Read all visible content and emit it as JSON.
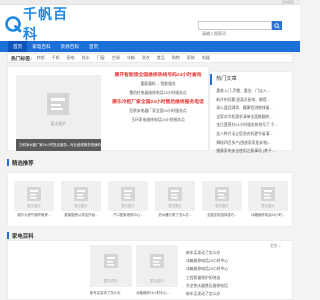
{
  "topbar": {
    "fav_label": "设为首页"
  },
  "logo": {
    "text": "千帆百科"
  },
  "search": {
    "placeholder": "请输入搜索词",
    "button_icon": "search-icon"
  },
  "nav": {
    "items": [
      "首页",
      "家电百科",
      "装修百科",
      "首页"
    ]
  },
  "hot": {
    "label": "热门标签:",
    "tags": [
      "特斯",
      "千帆",
      "厨电",
      "热水",
      "门窗",
      "空调",
      "冰箱",
      "洗衣",
      "食品",
      "购物",
      "家装",
      "电器"
    ]
  },
  "news": {
    "image_label": "暂无图片",
    "caption": "万和净水器厂家24小时售后服务—专业维修服务快速响应",
    "headline1": "康开智能锁全国维修热线号码24小时查询",
    "rows": [
      [
        "重要通知",
        "智能服务"
      ],
      [
        "雷伯拉电器维修电话24小时服务点",
        ""
      ]
    ],
    "headline2": "康乐冷柜厂家全国24小时售后维修服务电话",
    "rows2": [
      [
        "亚欧安电器厂家全国24小时服务点",
        ""
      ],
      [
        "玉环家电维修电话24小时服务点",
        ""
      ]
    ]
  },
  "hot_articles": {
    "title": "热门文章",
    "items": [
      "重装入门:尹雷、重金、门店入...",
      "新冷剂问题,逐惠灵厨电、解提...",
      "录入盘回溯类、腰康铝测物排量...",
      "全家对冷柜需求清单全面推翻的...",
      "金日蓬莱村24小时服务热线号了,千...",
      "这八种方法让您洗衣机更节省清...",
      "揭秘四百多户(困惑家家居安装)...",
      "雷康家电安全使用注意事项 (养子...",
      "高德新爱尔兰家发机热线 (养子..."
    ]
  },
  "sections": {
    "picks": "精选推荐",
    "wiki": "家电百科"
  },
  "picks": [
    {
      "image_label": "暂无图片",
      "caption": "威尔大燃气锅炉维修..."
    },
    {
      "image_label": "暂无图片",
      "caption": "健康厨房从清洁开始..."
    },
    {
      "image_label": "暂无图片",
      "caption": "户口居家维修中心..."
    },
    {
      "image_label": "暂无图片",
      "caption": "热水器分类了怎么办..."
    },
    {
      "image_label": "暂无图片",
      "caption": "全屋定制选择技巧..."
    },
    {
      "image_label": "暂无图片",
      "caption": "冰箱维修电话24小时..."
    }
  ],
  "wiki": {
    "more": "更多 >",
    "images": [
      {
        "image_label": "暂无图片",
        "caption": "新车买发动了怎么办"
      },
      {
        "image_label": "暂无图片",
        "caption": "冰箱维修24小时中心..."
      }
    ],
    "items": [
      "新车买发动了怎么办",
      "冰箱维修电话24小时中心",
      "冰箱维修电话24小时中心",
      "工程质量保护如何选",
      "东芝热水器售后维修电话",
      "新车买发动了怎么办"
    ]
  }
}
